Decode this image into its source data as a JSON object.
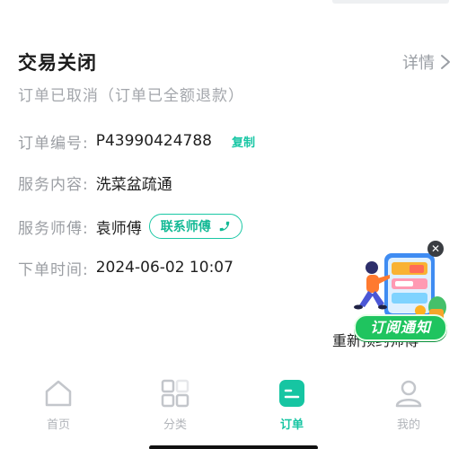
{
  "order": {
    "status_title": "交易关闭",
    "detail_link": "详情",
    "status_subtitle": "订单已取消（订单已全额退款）",
    "rows": [
      {
        "label": "订单编号:",
        "value": "P43990424788",
        "action": "复制"
      },
      {
        "label": "服务内容:",
        "value": "洗菜盆疏通"
      },
      {
        "label": "服务师傅:",
        "value": "袁师傅",
        "action": "联系师傅"
      },
      {
        "label": "下单时间:",
        "value": "2024-06-02 10:07"
      }
    ],
    "rebook_label": "重新预约师傅"
  },
  "promo": {
    "label": "订阅通知",
    "close_icon": "close-icon"
  },
  "tabbar": {
    "active_index": 2,
    "tabs": [
      {
        "label": "首页",
        "icon": "home-icon"
      },
      {
        "label": "分类",
        "icon": "category-icon"
      },
      {
        "label": "订单",
        "icon": "order-icon"
      },
      {
        "label": "我的",
        "icon": "profile-icon"
      }
    ]
  },
  "colors": {
    "accent": "#16c5a2",
    "promo_green": "#1fc45f",
    "label_gray": "#9b9ea3",
    "title": "#1c1c1c"
  }
}
